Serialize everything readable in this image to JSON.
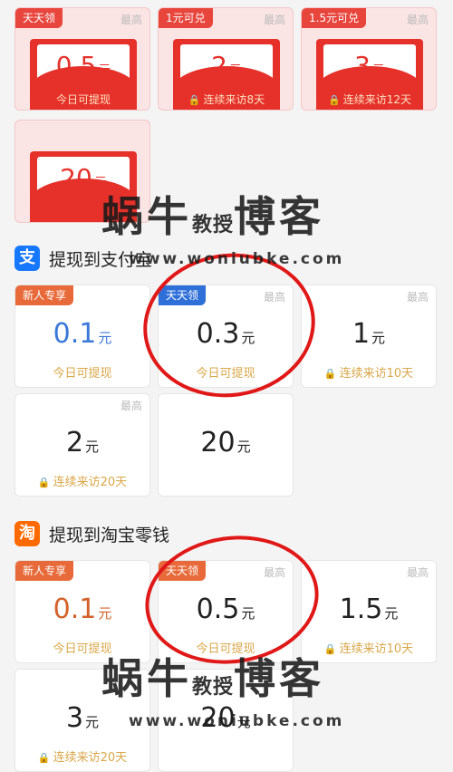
{
  "red_envelopes": [
    {
      "tag": "天天领",
      "max": "最高",
      "amount": "0.5",
      "unit": "元",
      "note": "今日可提现",
      "locked": false
    },
    {
      "tag": "1元可兑",
      "max": "最高",
      "amount": "2",
      "unit": "元",
      "note": "连续来访8天",
      "locked": true
    },
    {
      "tag": "1.5元可兑",
      "max": "最高",
      "amount": "3",
      "unit": "元",
      "note": "连续来访12天",
      "locked": true
    },
    {
      "tag": "",
      "max": "",
      "amount": "20",
      "unit": "元",
      "note": "",
      "locked": false
    }
  ],
  "alipay": {
    "icon_glyph": "支",
    "icon_color": "#1677ff",
    "title": "提现到支付宝",
    "options": [
      {
        "tag": "新人专享",
        "tag_color": "#e86a3a",
        "max": "",
        "amount": "0.1",
        "unit": "元",
        "note": "今日可提现",
        "amount_color": "#3b78d8",
        "locked": false
      },
      {
        "tag": "天天领",
        "tag_color": "#2f6fd8",
        "max": "最高",
        "amount": "0.3",
        "unit": "元",
        "note": "今日可提现",
        "amount_color": "#222222",
        "locked": false
      },
      {
        "tag": "",
        "tag_color": "",
        "max": "最高",
        "amount": "1",
        "unit": "元",
        "note": "连续来访10天",
        "amount_color": "#222222",
        "locked": true
      },
      {
        "tag": "",
        "tag_color": "",
        "max": "最高",
        "amount": "2",
        "unit": "元",
        "note": "连续来访20天",
        "amount_color": "#222222",
        "locked": true
      },
      {
        "tag": "",
        "tag_color": "",
        "max": "",
        "amount": "20",
        "unit": "元",
        "note": "",
        "amount_color": "#222222",
        "locked": false
      }
    ]
  },
  "taobao": {
    "icon_glyph": "淘",
    "icon_color": "#ff6a00",
    "title": "提现到淘宝零钱",
    "options": [
      {
        "tag": "新人专享",
        "tag_color": "#e86a3a",
        "max": "",
        "amount": "0.1",
        "unit": "元",
        "note": "今日可提现",
        "amount_color": "#d2622a",
        "locked": false
      },
      {
        "tag": "天天领",
        "tag_color": "#e86a3a",
        "max": "最高",
        "amount": "0.5",
        "unit": "元",
        "note": "今日可提现",
        "amount_color": "#222222",
        "locked": false
      },
      {
        "tag": "",
        "tag_color": "",
        "max": "最高",
        "amount": "1.5",
        "unit": "元",
        "note": "连续来访10天",
        "amount_color": "#222222",
        "locked": true
      },
      {
        "tag": "",
        "tag_color": "",
        "max": "",
        "amount": "3",
        "unit": "元",
        "note": "连续来访20天",
        "amount_color": "#222222",
        "locked": true
      },
      {
        "tag": "",
        "tag_color": "",
        "max": "",
        "amount": "20",
        "unit": "元",
        "note": "",
        "amount_color": "#222222",
        "locked": false
      }
    ]
  },
  "watermark": {
    "name_left": "蜗牛",
    "name_mid": "教授",
    "name_right": "博客",
    "url": "www.woniubke.com"
  }
}
